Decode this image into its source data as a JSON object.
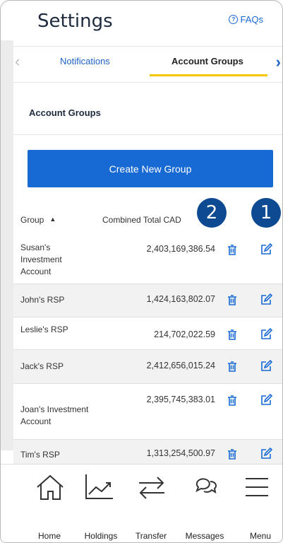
{
  "header": {
    "title": "Settings",
    "faq_label": "FAQs"
  },
  "tabs": {
    "notifications": "Notifications",
    "account_groups": "Account Groups"
  },
  "section": {
    "title": "Account Groups",
    "create_button": "Create New Group"
  },
  "table": {
    "col_group": "Group",
    "col_total": "Combined Total CAD",
    "rows": [
      {
        "name": "Susan's Investment Account",
        "value": "2,403,169,386.54"
      },
      {
        "name": "John's RSP",
        "value": "1,424,163,802.07"
      },
      {
        "name": "Leslie's RSP",
        "value": "214,702,022.59"
      },
      {
        "name": "Jack's RSP",
        "value": "2,412,656,015.24"
      },
      {
        "name": "Joan's Investment Account",
        "value": "2,395,745,383.01"
      },
      {
        "name": "Tim's RSP",
        "value": "1,313,254,500.97"
      }
    ]
  },
  "badges": {
    "one": "1",
    "two": "2"
  },
  "nav": {
    "home": "Home",
    "holdings": "Holdings",
    "transfer": "Transfer",
    "messages": "Messages",
    "menu": "Menu"
  },
  "colors": {
    "accent": "#1769d3",
    "badge": "#0d4a91",
    "tab_underline": "#f5c800"
  }
}
